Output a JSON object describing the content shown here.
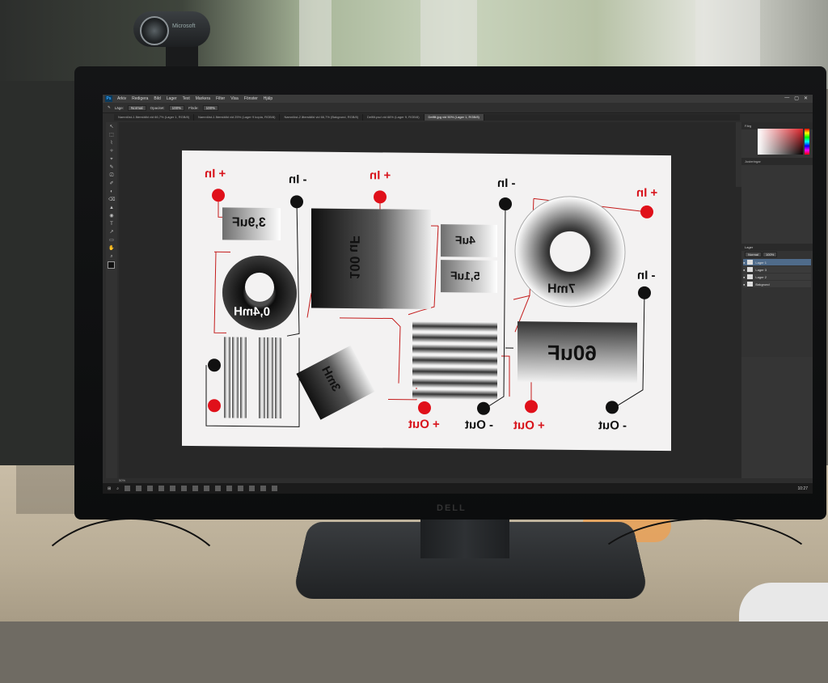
{
  "webcam": {
    "brand": "Microsoft"
  },
  "monitor": {
    "brand": "DELL"
  },
  "photoshop": {
    "logo": "Ps",
    "menus": [
      "Arkiv",
      "Redigera",
      "Bild",
      "Lager",
      "Text",
      "Markera",
      "Filter",
      "Visa",
      "Fönster",
      "Hjälp"
    ],
    "window_controls": [
      "—",
      "▢",
      "✕"
    ],
    "options": {
      "mode_label": "Läge:",
      "mode_value": "Normal",
      "opacity_label": "Opacitet:",
      "opacity_value": "100%",
      "flow_label": "Flöde:",
      "flow_value": "100%"
    },
    "tabs": [
      "Namnlöst-1 återställd vid 66,7% (Lager 1, RGB/8)",
      "Namnlöst-1 återställd vid 25% (Lager 9 kopia, RGB/8)",
      "Namnlöst-2 återställd vid 66,7% (Bakgrund, RGB/8)",
      "Delfilt.psd vid 66% (Lager 9, RGB/8)",
      "Delfilt.jpg vid 50% (Lager 1, RGB/8)"
    ],
    "active_tab_index": 4,
    "tools": [
      "↖",
      "⬚",
      "⌇",
      "✧",
      "⌖",
      "✎",
      "⎚",
      "✐",
      "◐",
      "⌫",
      "▲",
      "◉",
      "T",
      "↗",
      "▭",
      "✋",
      "⌕"
    ],
    "panels": {
      "color_tab": "Färg",
      "adjust_tab": "Justeringar",
      "layers_tab": "Lager",
      "blend_mode": "Normal",
      "opacity": "100%"
    },
    "layers": [
      {
        "name": "Lager 1",
        "selected": true
      },
      {
        "name": "Lager 3",
        "selected": false
      },
      {
        "name": "Lager 2",
        "selected": false
      },
      {
        "name": "Bakgrund",
        "selected": false
      }
    ],
    "status": "50%",
    "taskbar_clock": "10:27"
  },
  "document": {
    "labels": {
      "in_plus_1": "+ In",
      "in_minus_1": "- In",
      "in_plus_2": "+ In",
      "in_minus_2": "- In",
      "in_plus_3": "+ In",
      "in_minus_3": "- In",
      "out_plus_1": "+ Out",
      "out_minus_1": "- Out",
      "out_plus_2": "+ Out",
      "out_minus_2": "- Out"
    },
    "components": {
      "cap_3_9uF": "3,9uF",
      "ind_0_4mH": "0,4mH",
      "cap_100uF": "100 uF",
      "cap_4uF": "4uF",
      "cap_5_1uF": "5,1uF",
      "ind_7mH": "7mH",
      "cap_60uF": "60uF",
      "ind_3mH": "3mH"
    },
    "colors": {
      "red": "#d8141c",
      "black": "#111111",
      "wire_red": "#c41b1b"
    }
  }
}
